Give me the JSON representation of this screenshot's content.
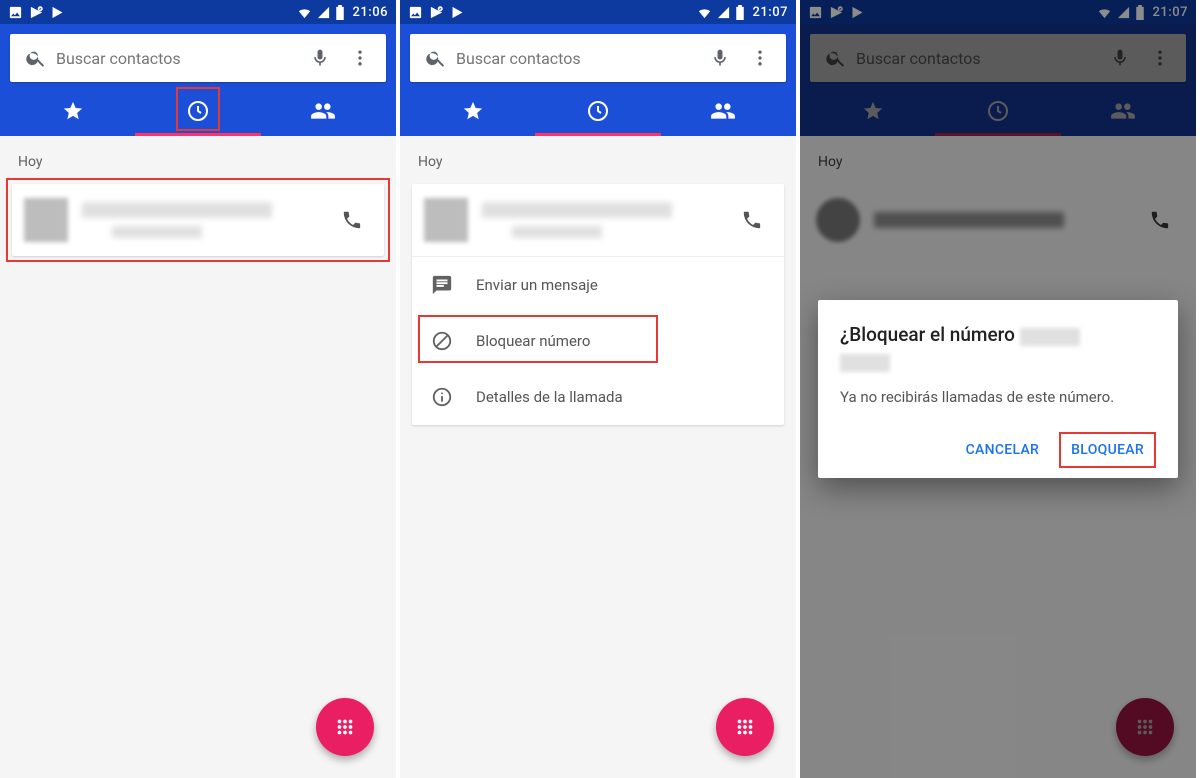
{
  "status": {
    "time1": "21:06",
    "time2": "21:07",
    "time3": "21:07"
  },
  "search": {
    "placeholder": "Buscar contactos"
  },
  "section_label": "Hoy",
  "menu": {
    "send_message": "Enviar un mensaje",
    "block_number": "Bloquear número",
    "call_details": "Detalles de la llamada"
  },
  "dialog": {
    "title_prefix": "¿Bloquear el número",
    "message": "Ya no recibirás llamadas de este número.",
    "cancel": "CANCELAR",
    "confirm": "BLOQUEAR"
  }
}
